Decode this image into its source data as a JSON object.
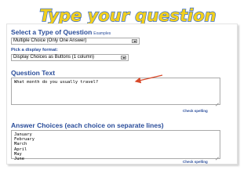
{
  "slide_title": "Type your question",
  "section_type": {
    "label": "Select a Type of Question",
    "examples_link": "Examples",
    "selected": "Multiple Choice (Only One Answer)"
  },
  "display_format": {
    "label": "Pick a display format:",
    "selected": "Display Choices as Buttons (1 column)"
  },
  "question": {
    "label": "Question Text",
    "value": "What month do you usually travel?",
    "check_spelling": "Check spelling"
  },
  "answers": {
    "label": "Answer Choices (each choice on separate lines)",
    "lines": [
      "January",
      "February",
      "March",
      "April",
      "May",
      "June"
    ],
    "check_spelling": "Check spelling"
  },
  "colors": {
    "title_fill": "#f2cf1d",
    "title_outline": "#3a6fd0",
    "label_blue": "#2a4d9a",
    "annotation_arrow": "#d84a2a"
  }
}
